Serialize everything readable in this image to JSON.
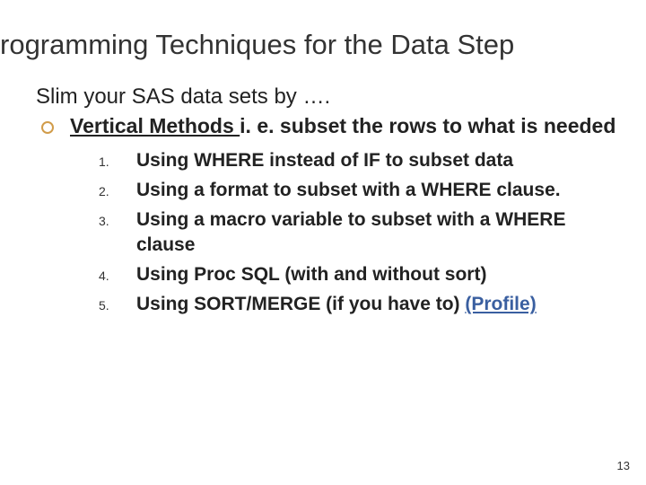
{
  "title": "rogramming Techniques for the Data Step",
  "lead": "Slim your SAS data sets by ….",
  "sub": {
    "underlined": "Vertical Methods ",
    "rest": "i. e. subset the rows to what is needed"
  },
  "items": [
    "Using WHERE instead of IF to subset data",
    "Using a format to subset with a WHERE clause.",
    "Using a macro variable to subset with a WHERE clause",
    "Using Proc SQL (with and without sort)"
  ],
  "last_item": {
    "text": "Using SORT/MERGE (if you have to) ",
    "link": "(Profile)"
  },
  "page_number": "13"
}
